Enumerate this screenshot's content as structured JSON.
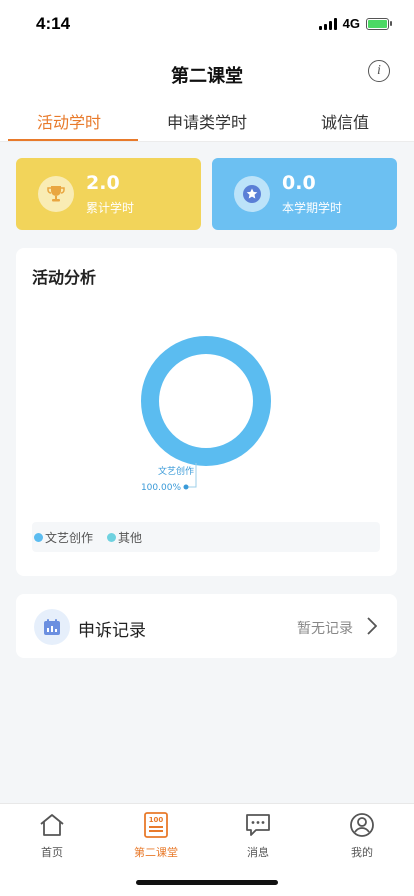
{
  "status_bar": {
    "time": "4:14",
    "network": "4G"
  },
  "nav": {
    "title": "第二课堂"
  },
  "tabs": [
    {
      "label": "活动学时",
      "active": true
    },
    {
      "label": "申请类学时",
      "active": false
    },
    {
      "label": "诚信值",
      "active": false
    }
  ],
  "stats": [
    {
      "value": "2.0",
      "label": "累计学时",
      "color": "#f2d45a",
      "icon": "trophy-icon"
    },
    {
      "value": "0.0",
      "label": "本学期学时",
      "color": "#6cc0f2",
      "icon": "star-badge-icon"
    }
  ],
  "analysis": {
    "title": "活动分析",
    "legend": [
      {
        "label": "文艺创作",
        "color": "#5bbcf0"
      },
      {
        "label": "其他",
        "color": "#6fd2e0"
      }
    ]
  },
  "chart_data": {
    "type": "pie",
    "categories": [
      "文艺创作"
    ],
    "values": [
      100
    ],
    "annotations": [
      {
        "label": "文艺创作",
        "value_text": "100.00%"
      }
    ],
    "colors": [
      "#5bbcf0"
    ]
  },
  "appeal": {
    "title": "申诉记录",
    "status": "暂无记录"
  },
  "tabbar": [
    {
      "label": "首页",
      "icon": "home-icon",
      "active": false
    },
    {
      "label": "第二课堂",
      "icon": "classroom-icon",
      "active": true
    },
    {
      "label": "消息",
      "icon": "message-icon",
      "active": false
    },
    {
      "label": "我的",
      "icon": "profile-icon",
      "active": false
    }
  ],
  "colors": {
    "accent": "#e87a2b"
  }
}
